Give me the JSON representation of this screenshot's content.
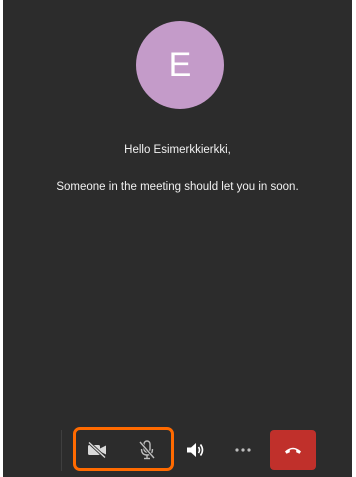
{
  "participant": {
    "avatar_initial": "E",
    "avatar_color": "#c49bc9"
  },
  "lobby": {
    "greeting": "Hello Esimerkkierkki,",
    "message": "Someone in the meeting should let you in soon."
  },
  "controls": [
    {
      "id": "camera",
      "icon": "camera-off-icon",
      "state": "off"
    },
    {
      "id": "microphone",
      "icon": "microphone-off-icon",
      "state": "off"
    },
    {
      "id": "speaker",
      "icon": "speaker-icon",
      "state": "on"
    },
    {
      "id": "more",
      "icon": "more-options-icon"
    },
    {
      "id": "hang-up",
      "icon": "hang-up-icon",
      "color": "#c0302b"
    }
  ],
  "highlight_color": "#ff6a00"
}
